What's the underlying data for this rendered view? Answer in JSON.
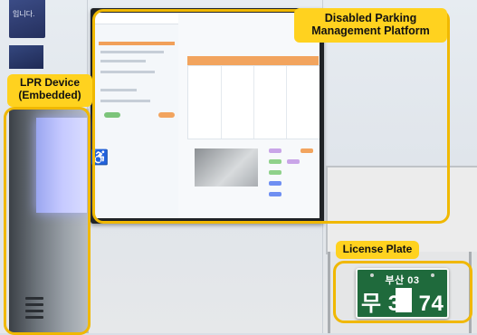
{
  "callouts": {
    "platform": "Disabled Parking Management Platform",
    "lpr": "LPR Device (Embedded)",
    "plate": "License Plate"
  },
  "license_plate": {
    "region_line": "부산 03",
    "number_prefix": "무 3",
    "number_suffix": "74"
  },
  "background_sign": {
    "text": "입니다."
  },
  "colors": {
    "callout_fill": "#ffd21f",
    "frame_stroke": "#f0b800",
    "plate_green": "#1f6a3c",
    "lpr_light": "#c5c9ff"
  },
  "icons": [
    "wheelchair-accessibility-icon"
  ]
}
